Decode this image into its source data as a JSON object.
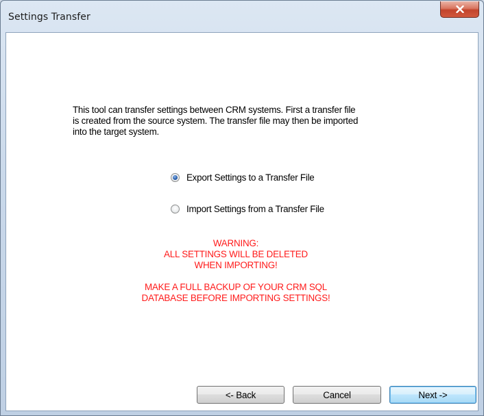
{
  "window": {
    "title": "Settings Transfer",
    "close_symbol": "X"
  },
  "content": {
    "description_lines": [
      "This tool can transfer settings between CRM systems. First a transfer file",
      "is created from the source system. The transfer file may then be imported",
      "into the target system."
    ],
    "options": [
      {
        "label": "Export Settings to a Transfer File",
        "checked": true
      },
      {
        "label": "Import Settings from a Transfer File",
        "checked": false
      }
    ],
    "warning_lines_1": [
      "WARNING:",
      "ALL SETTINGS WILL BE DELETED",
      "WHEN IMPORTING!"
    ],
    "warning_lines_2": [
      "MAKE A FULL BACKUP OF YOUR CRM SQL",
      "DATABASE BEFORE IMPORTING SETTINGS!"
    ],
    "warning_color": "#ff1a1a"
  },
  "buttons": {
    "back": "<- Back",
    "cancel": "Cancel",
    "next": "Next ->"
  }
}
